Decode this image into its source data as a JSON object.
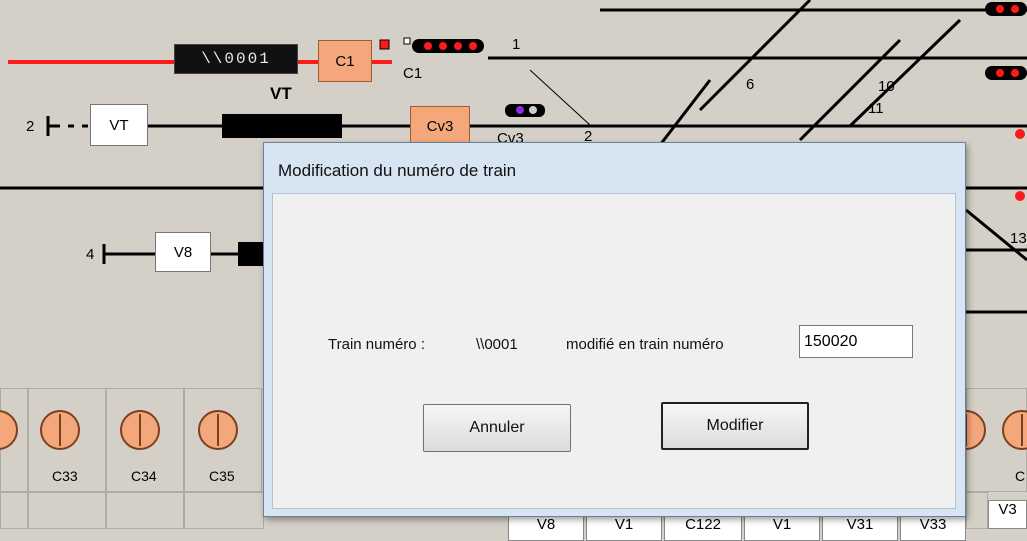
{
  "track": {
    "train_number_display": "\\\\0001",
    "labels": {
      "c1_box": "C1",
      "c1_under": "C1",
      "vt_over": "VT",
      "vt_box": "VT",
      "cv3_box": "Cv3",
      "cv3_under": "Cv3",
      "v8_box": "V8",
      "track_1": "1",
      "track_2": "2",
      "track_2b": "2",
      "track_4": "4",
      "track_6": "6",
      "track_10": "10",
      "track_11": "11",
      "track_13": "13"
    }
  },
  "panel": {
    "knobs": [
      "C33",
      "C34",
      "C35",
      "C"
    ],
    "bottom_tabs": [
      "V8",
      "V1",
      "C122",
      "V1",
      "V31",
      "V33",
      "V3"
    ]
  },
  "dialog": {
    "title": "Modification du numéro de train",
    "label_prefix": "Train numéro :",
    "current_number": "\\\\0001",
    "label_suffix": "modifié en train numéro",
    "new_number_value": "150020",
    "cancel_label": "Annuler",
    "confirm_label": "Modifier"
  },
  "colors": {
    "active_track": "#ff1a1a",
    "signal_box": "#f4a77a",
    "dialog_frame": "#d7e4f2"
  }
}
